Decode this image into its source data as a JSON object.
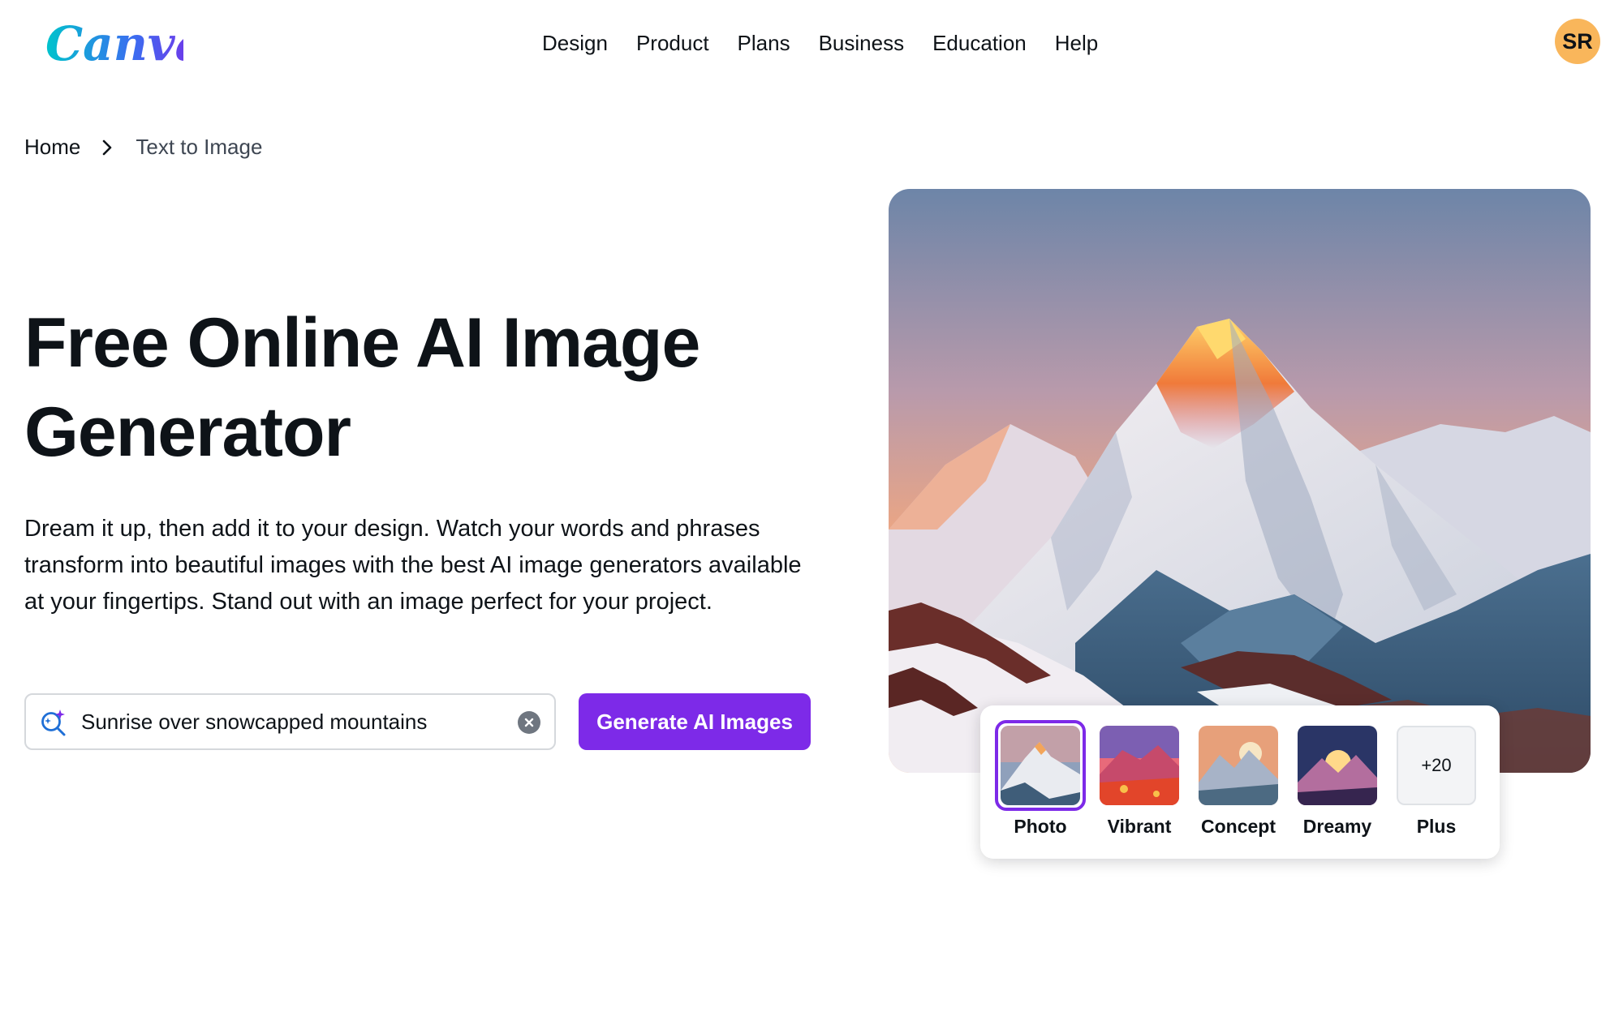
{
  "brand": {
    "logo_text": "Canva"
  },
  "nav": {
    "items": [
      {
        "label": "Design"
      },
      {
        "label": "Product"
      },
      {
        "label": "Plans"
      },
      {
        "label": "Business"
      },
      {
        "label": "Education"
      },
      {
        "label": "Help"
      }
    ]
  },
  "user": {
    "initials": "SR",
    "avatar_color": "#f9b65b"
  },
  "breadcrumb": {
    "home": "Home",
    "current": "Text to Image"
  },
  "hero": {
    "title": "Free Online AI Image Generator",
    "description": "Dream it up, then add it to your design. Watch your words and phrases transform into beautiful images with the best AI image generators available at your fingertips. Stand out with an image perfect for your project."
  },
  "search": {
    "value": "Sunrise over snowcapped mountains",
    "icon": "magic-search-icon",
    "clear_icon": "clear-icon"
  },
  "generate_button": {
    "label": "Generate AI Images"
  },
  "styles": {
    "selected": "Photo",
    "items": [
      {
        "label": "Photo",
        "thumb": ""
      },
      {
        "label": "Vibrant",
        "thumb": ""
      },
      {
        "label": "Concept",
        "thumb": ""
      },
      {
        "label": "Dreamy",
        "thumb": ""
      },
      {
        "label": "Plus",
        "thumb": "+20"
      }
    ]
  },
  "colors": {
    "accent": "#7d2ae8",
    "text": "#0e1318"
  }
}
